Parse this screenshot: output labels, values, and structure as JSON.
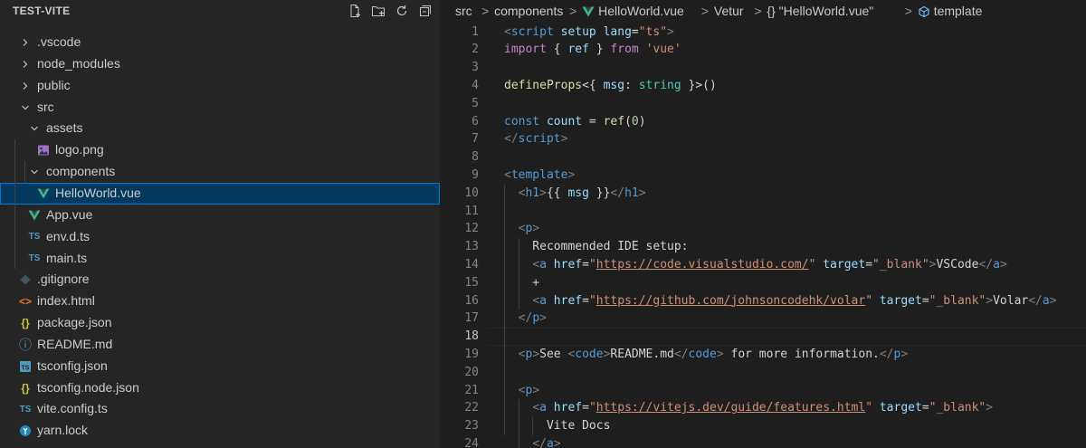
{
  "explorer": {
    "title": "TEST-VITE",
    "actions": [
      "new-file-icon",
      "new-folder-icon",
      "refresh-icon",
      "collapse-all-icon"
    ],
    "tree": [
      {
        "label": ".vscode",
        "type": "folder",
        "expanded": false,
        "depth": 0
      },
      {
        "label": "node_modules",
        "type": "folder",
        "expanded": false,
        "depth": 0
      },
      {
        "label": "public",
        "type": "folder",
        "expanded": false,
        "depth": 0
      },
      {
        "label": "src",
        "type": "folder",
        "expanded": true,
        "depth": 0
      },
      {
        "label": "assets",
        "type": "folder",
        "expanded": true,
        "depth": 1
      },
      {
        "label": "logo.png",
        "type": "file",
        "icon": "image-file-icon",
        "depth": 2
      },
      {
        "label": "components",
        "type": "folder",
        "expanded": true,
        "depth": 1
      },
      {
        "label": "HelloWorld.vue",
        "type": "file",
        "icon": "vue-file-icon",
        "depth": 2,
        "selected": true
      },
      {
        "label": "App.vue",
        "type": "file",
        "icon": "vue-file-icon",
        "depth": 1
      },
      {
        "label": "env.d.ts",
        "type": "file",
        "icon": "ts-file-icon",
        "icon_text": "TS",
        "depth": 1
      },
      {
        "label": "main.ts",
        "type": "file",
        "icon": "ts-file-icon",
        "icon_text": "TS",
        "depth": 1
      },
      {
        "label": ".gitignore",
        "type": "file",
        "icon": "git-file-icon",
        "depth": 0
      },
      {
        "label": "index.html",
        "type": "file",
        "icon": "html-file-icon",
        "icon_text": "<>",
        "depth": 0
      },
      {
        "label": "package.json",
        "type": "file",
        "icon": "json-file-icon",
        "icon_text": "{}",
        "depth": 0
      },
      {
        "label": "README.md",
        "type": "file",
        "icon": "info-file-icon",
        "icon_text": "ⓘ",
        "depth": 0
      },
      {
        "label": "tsconfig.json",
        "type": "file",
        "icon": "tsconfig-file-icon",
        "icon_text": "TS",
        "depth": 0
      },
      {
        "label": "tsconfig.node.json",
        "type": "file",
        "icon": "json-file-icon",
        "icon_text": "{}",
        "depth": 0
      },
      {
        "label": "vite.config.ts",
        "type": "file",
        "icon": "ts-file-icon",
        "icon_text": "TS",
        "depth": 0
      },
      {
        "label": "yarn.lock",
        "type": "file",
        "icon": "yarn-file-icon",
        "depth": 0
      }
    ]
  },
  "breadcrumb": {
    "items": [
      "src",
      "components",
      "HelloWorld.vue",
      "Vetur",
      "{} \"HelloWorld.vue\"",
      "template"
    ],
    "separator": ">"
  },
  "editor": {
    "active_line": 18,
    "lines": [
      {
        "n": "1",
        "tokens": [
          [
            "tag",
            "<"
          ],
          [
            "tn",
            "script"
          ],
          [
            "txt",
            " "
          ],
          [
            "attr",
            "setup"
          ],
          [
            "txt",
            " "
          ],
          [
            "attr",
            "lang"
          ],
          [
            "txt",
            "="
          ],
          [
            "str",
            "\"ts\""
          ],
          [
            "tag",
            ">"
          ]
        ]
      },
      {
        "n": "2",
        "tokens": [
          [
            "kw",
            "import"
          ],
          [
            "txt",
            " { "
          ],
          [
            "attr",
            "ref"
          ],
          [
            "txt",
            " } "
          ],
          [
            "kw",
            "from"
          ],
          [
            "txt",
            " "
          ],
          [
            "str",
            "'vue'"
          ]
        ]
      },
      {
        "n": "3",
        "tokens": []
      },
      {
        "n": "4",
        "tokens": [
          [
            "fn",
            "defineProps"
          ],
          [
            "txt",
            "<{ "
          ],
          [
            "attr",
            "msg"
          ],
          [
            "txt",
            ": "
          ],
          [
            "type",
            "string"
          ],
          [
            "txt",
            " }>()"
          ]
        ]
      },
      {
        "n": "5",
        "tokens": []
      },
      {
        "n": "6",
        "tokens": [
          [
            "const",
            "const"
          ],
          [
            "txt",
            " "
          ],
          [
            "attr",
            "count"
          ],
          [
            "txt",
            " = "
          ],
          [
            "fn",
            "ref"
          ],
          [
            "txt",
            "("
          ],
          [
            "num",
            "0"
          ],
          [
            "txt",
            ")"
          ]
        ]
      },
      {
        "n": "7",
        "tokens": [
          [
            "tag",
            "</"
          ],
          [
            "tn",
            "script"
          ],
          [
            "tag",
            ">"
          ]
        ]
      },
      {
        "n": "8",
        "tokens": []
      },
      {
        "n": "9",
        "tokens": [
          [
            "tag",
            "<"
          ],
          [
            "tn",
            "template"
          ],
          [
            "tag",
            ">"
          ]
        ]
      },
      {
        "n": "10",
        "tokens": [
          [
            "txt",
            "  "
          ],
          [
            "tag",
            "<"
          ],
          [
            "tn",
            "h1"
          ],
          [
            "tag",
            ">"
          ],
          [
            "txt",
            "{{ "
          ],
          [
            "attr",
            "msg"
          ],
          [
            "txt",
            " }}"
          ],
          [
            "tag",
            "</"
          ],
          [
            "tn",
            "h1"
          ],
          [
            "tag",
            ">"
          ]
        ]
      },
      {
        "n": "11",
        "tokens": []
      },
      {
        "n": "12",
        "tokens": [
          [
            "txt",
            "  "
          ],
          [
            "tag",
            "<"
          ],
          [
            "tn",
            "p"
          ],
          [
            "tag",
            ">"
          ]
        ]
      },
      {
        "n": "13",
        "tokens": [
          [
            "txt",
            "    Recommended IDE setup:"
          ]
        ]
      },
      {
        "n": "14",
        "tokens": [
          [
            "txt",
            "    "
          ],
          [
            "tag",
            "<"
          ],
          [
            "tn",
            "a"
          ],
          [
            "txt",
            " "
          ],
          [
            "attr",
            "href"
          ],
          [
            "txt",
            "="
          ],
          [
            "str",
            "\""
          ],
          [
            "link",
            "https://code.visualstudio.com/"
          ],
          [
            "str",
            "\""
          ],
          [
            "txt",
            " "
          ],
          [
            "attr",
            "target"
          ],
          [
            "txt",
            "="
          ],
          [
            "str",
            "\"_blank\""
          ],
          [
            "tag",
            ">"
          ],
          [
            "txt",
            "VSCode"
          ],
          [
            "tag",
            "</"
          ],
          [
            "tn",
            "a"
          ],
          [
            "tag",
            ">"
          ]
        ]
      },
      {
        "n": "15",
        "tokens": [
          [
            "txt",
            "    +"
          ]
        ]
      },
      {
        "n": "16",
        "tokens": [
          [
            "txt",
            "    "
          ],
          [
            "tag",
            "<"
          ],
          [
            "tn",
            "a"
          ],
          [
            "txt",
            " "
          ],
          [
            "attr",
            "href"
          ],
          [
            "txt",
            "="
          ],
          [
            "str",
            "\""
          ],
          [
            "link",
            "https://github.com/johnsoncodehk/volar"
          ],
          [
            "str",
            "\""
          ],
          [
            "txt",
            " "
          ],
          [
            "attr",
            "target"
          ],
          [
            "txt",
            "="
          ],
          [
            "str",
            "\"_blank\""
          ],
          [
            "tag",
            ">"
          ],
          [
            "txt",
            "Volar"
          ],
          [
            "tag",
            "</"
          ],
          [
            "tn",
            "a"
          ],
          [
            "tag",
            ">"
          ]
        ]
      },
      {
        "n": "17",
        "tokens": [
          [
            "txt",
            "  "
          ],
          [
            "tag",
            "</"
          ],
          [
            "tn",
            "p"
          ],
          [
            "tag",
            ">"
          ]
        ]
      },
      {
        "n": "18",
        "tokens": []
      },
      {
        "n": "19",
        "tokens": [
          [
            "txt",
            "  "
          ],
          [
            "tag",
            "<"
          ],
          [
            "tn",
            "p"
          ],
          [
            "tag",
            ">"
          ],
          [
            "txt",
            "See "
          ],
          [
            "tag",
            "<"
          ],
          [
            "tn",
            "code"
          ],
          [
            "tag",
            ">"
          ],
          [
            "txt",
            "README.md"
          ],
          [
            "tag",
            "</"
          ],
          [
            "tn",
            "code"
          ],
          [
            "tag",
            ">"
          ],
          [
            "txt",
            " for more information."
          ],
          [
            "tag",
            "</"
          ],
          [
            "tn",
            "p"
          ],
          [
            "tag",
            ">"
          ]
        ]
      },
      {
        "n": "20",
        "tokens": []
      },
      {
        "n": "21",
        "tokens": [
          [
            "txt",
            "  "
          ],
          [
            "tag",
            "<"
          ],
          [
            "tn",
            "p"
          ],
          [
            "tag",
            ">"
          ]
        ]
      },
      {
        "n": "22",
        "tokens": [
          [
            "txt",
            "    "
          ],
          [
            "tag",
            "<"
          ],
          [
            "tn",
            "a"
          ],
          [
            "txt",
            " "
          ],
          [
            "attr",
            "href"
          ],
          [
            "txt",
            "="
          ],
          [
            "str",
            "\""
          ],
          [
            "link",
            "https://vitejs.dev/guide/features.html"
          ],
          [
            "str",
            "\""
          ],
          [
            "txt",
            " "
          ],
          [
            "attr",
            "target"
          ],
          [
            "txt",
            "="
          ],
          [
            "str",
            "\"_blank\""
          ],
          [
            "tag",
            ">"
          ]
        ]
      },
      {
        "n": "23",
        "tokens": [
          [
            "txt",
            "      Vite Docs"
          ]
        ]
      },
      {
        "n": "24",
        "tokens": [
          [
            "txt",
            "    "
          ],
          [
            "tag",
            "</"
          ],
          [
            "tn",
            "a"
          ],
          [
            "tag",
            ">"
          ]
        ]
      }
    ]
  },
  "colors": {
    "sidebar_bg": "#252526",
    "editor_bg": "#1e1e1e",
    "selection_bg": "#04395e",
    "selection_border": "#0078d4",
    "vue_green": "#41b883",
    "ts_blue": "#519aba"
  }
}
